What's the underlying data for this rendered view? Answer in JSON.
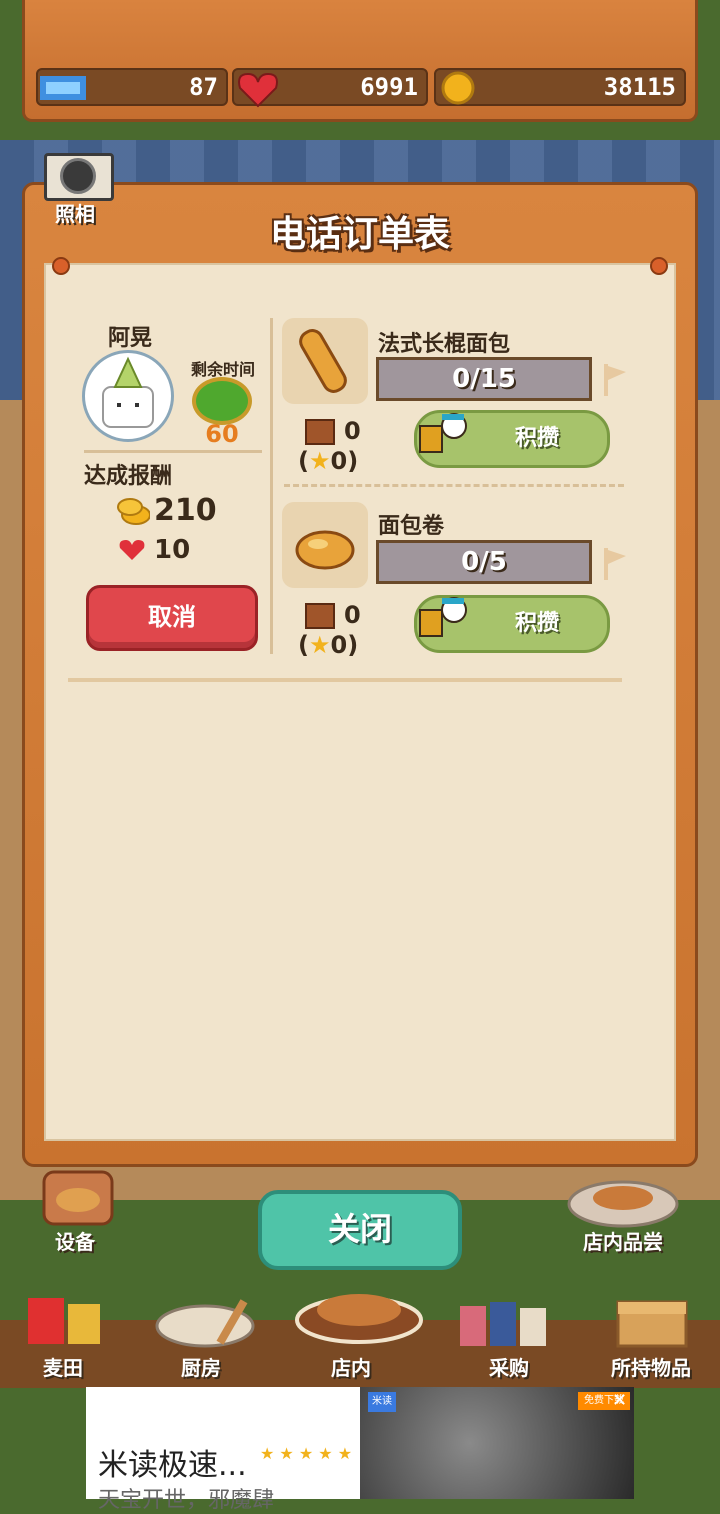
{
  "stats": {
    "tickets": "87",
    "hearts": "6991",
    "coins": "38115"
  },
  "camera": {
    "label": "照相"
  },
  "panel": {
    "title": "电话订单表"
  },
  "customer": {
    "name": "阿晃",
    "time_label": "剩余时间",
    "time_value": "60"
  },
  "reward": {
    "label": "达成报酬",
    "coins": "210",
    "hearts": "10"
  },
  "cancel": {
    "label": "取消"
  },
  "items": [
    {
      "name": "法式长棍面包",
      "progress": "0/15",
      "stock": "0",
      "star": "0",
      "button": "积攒"
    },
    {
      "name": "面包卷",
      "progress": "0/5",
      "stock": "0",
      "star": "0",
      "button": "积攒"
    }
  ],
  "close": {
    "label": "关闭"
  },
  "side": {
    "equipment": "设备",
    "tasting": "店内品尝"
  },
  "nav": {
    "field": "麦田",
    "kitchen": "厨房",
    "store": "店内",
    "purchase": "采购",
    "inventory": "所持物品"
  },
  "ad": {
    "title": "米读极速...",
    "subtitle": "天宝开世，邪魔肆",
    "app_badge": "米读",
    "corner_badge": "免费下载"
  },
  "colors": {
    "accent_green": "#4fc4a8",
    "cancel_red": "#e0474c",
    "wood": "#c9732f"
  }
}
